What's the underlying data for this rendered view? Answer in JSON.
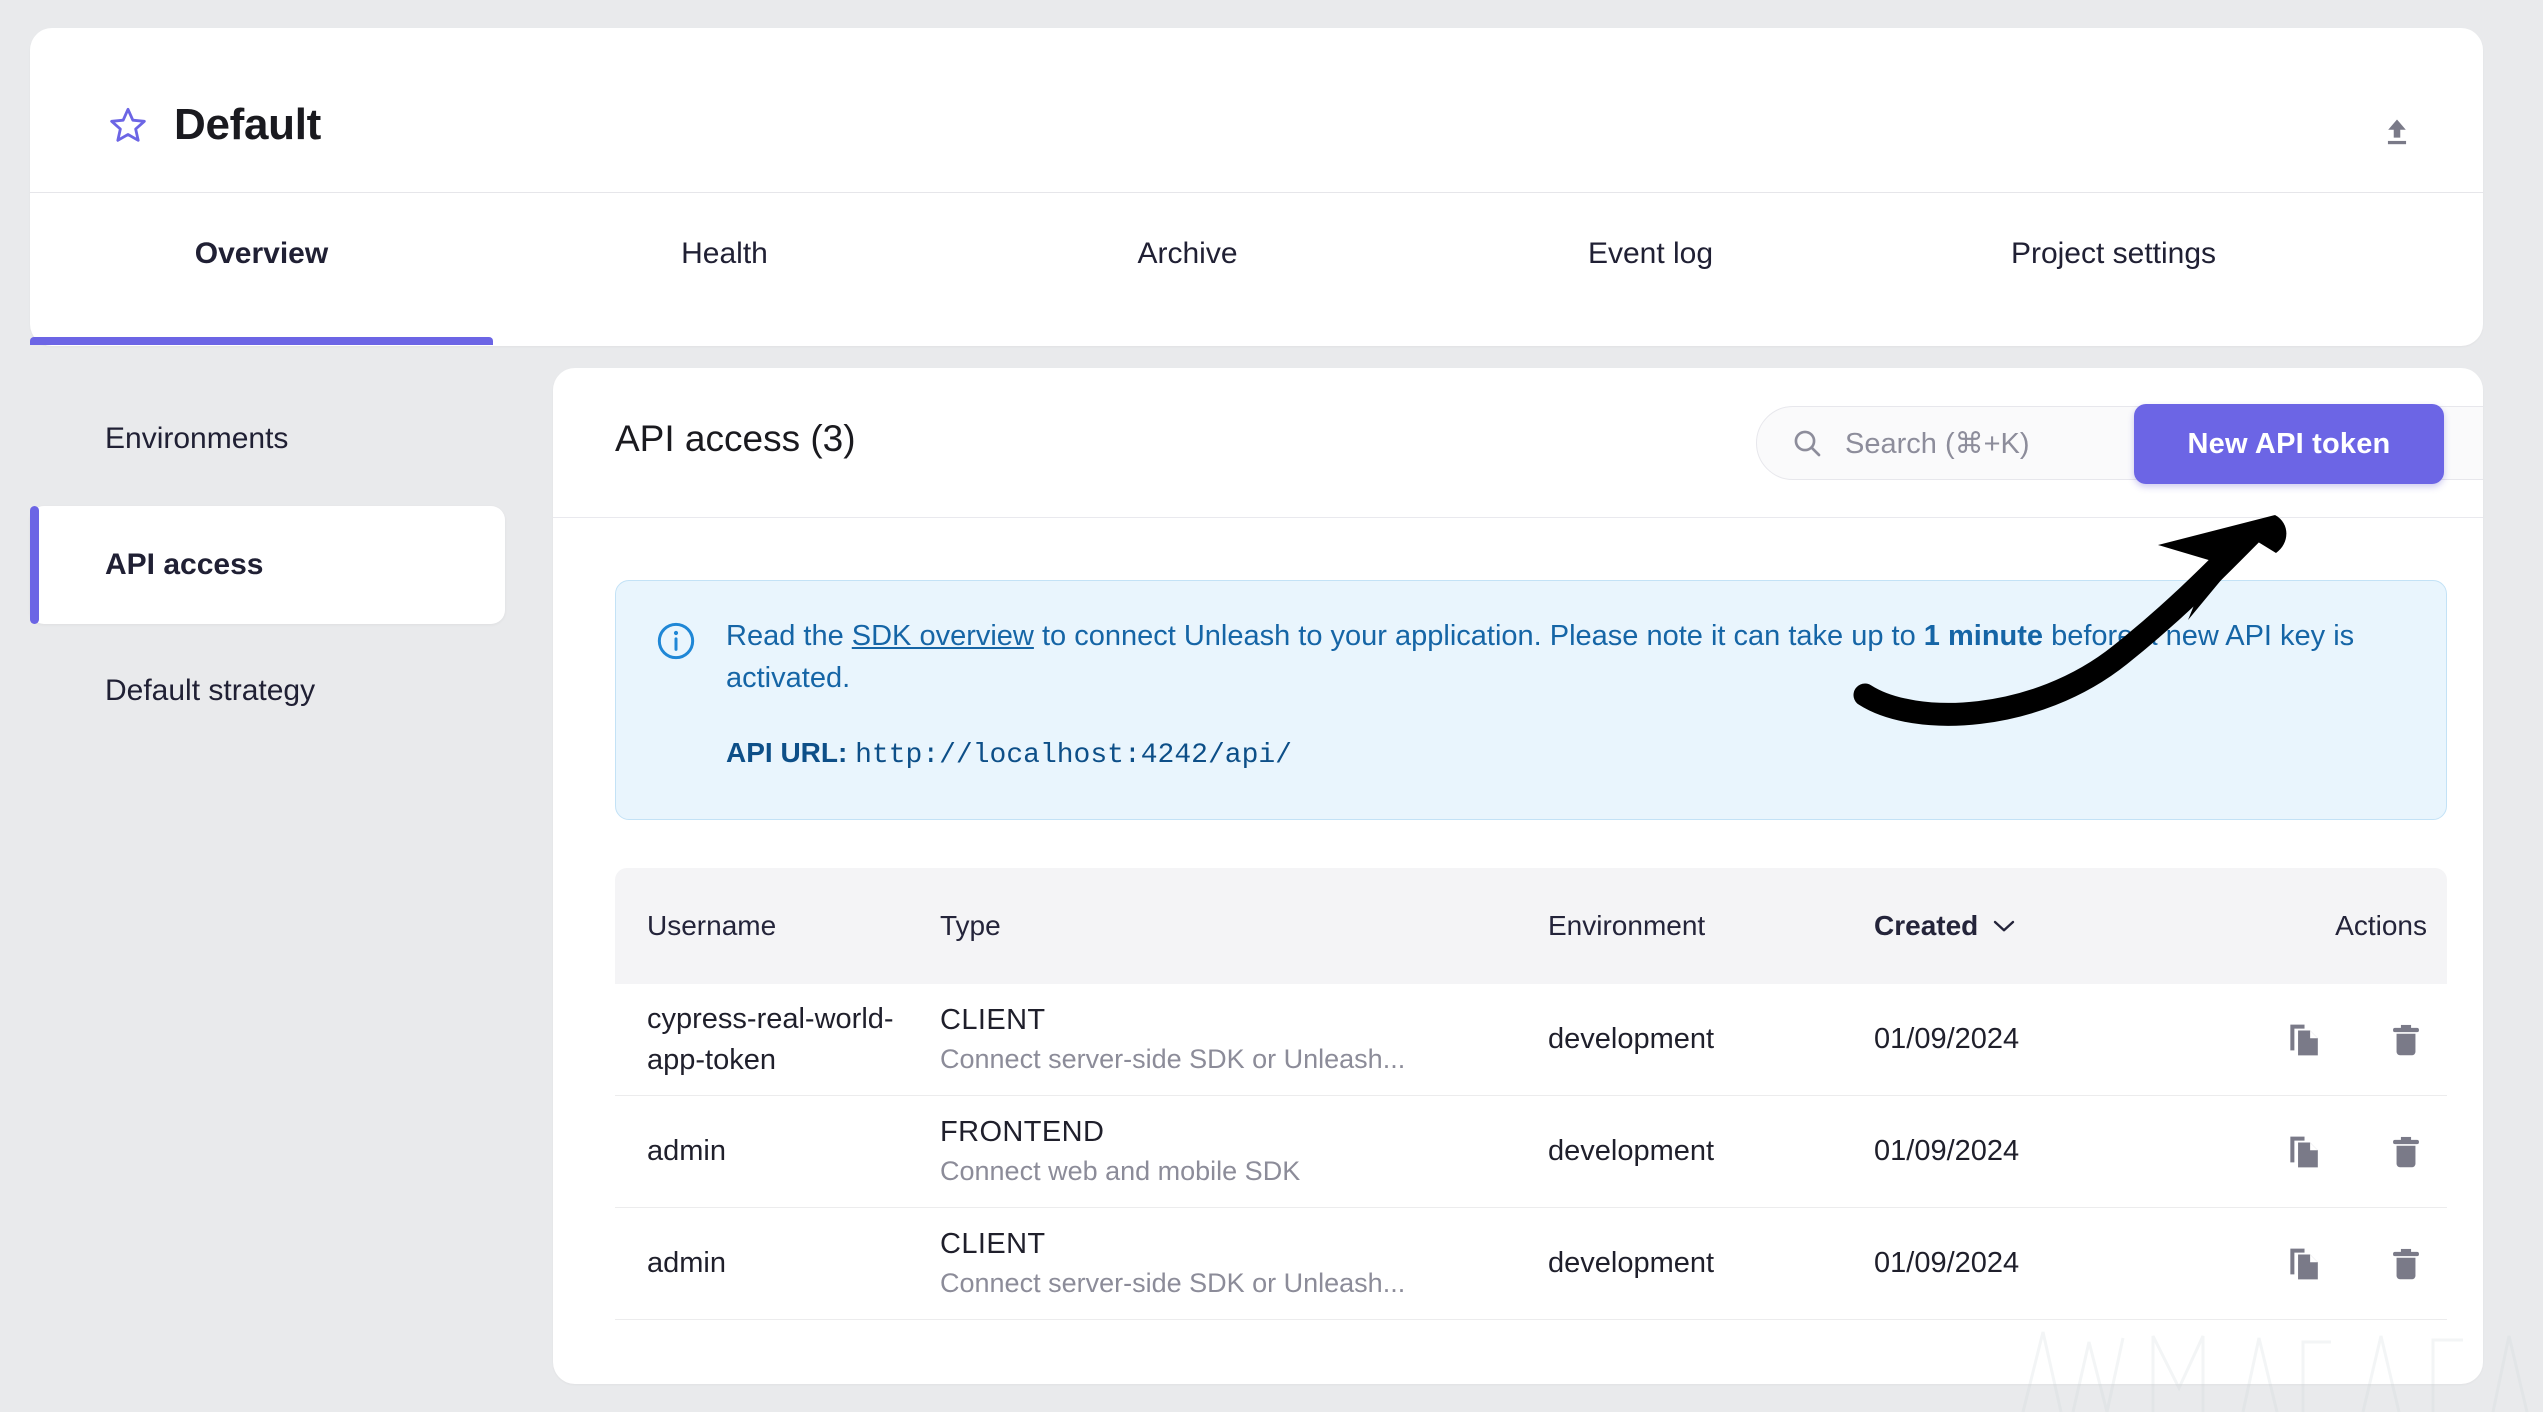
{
  "header": {
    "project_title": "Default",
    "favorite_icon": "star-icon",
    "export_icon": "upload-icon"
  },
  "tabs": [
    {
      "label": "Overview",
      "active": true
    },
    {
      "label": "Health",
      "active": false
    },
    {
      "label": "Archive",
      "active": false
    },
    {
      "label": "Event log",
      "active": false
    },
    {
      "label": "Project settings",
      "active": false
    }
  ],
  "sidebar": {
    "items": [
      {
        "label": "Environments",
        "active": false
      },
      {
        "label": "API access",
        "active": true
      },
      {
        "label": "Default strategy",
        "active": false
      }
    ]
  },
  "main": {
    "title": "API access (3)",
    "search": {
      "placeholder": "Search (⌘+K)",
      "value": "",
      "icon": "search-icon"
    },
    "new_token_button": "New API token",
    "alert": {
      "icon": "info-circle-icon",
      "text_before_link": "Read the ",
      "link_text": "SDK overview",
      "text_after_link": " to connect Unleash to your application. Please note it can take up to ",
      "emphasis": "1 minute",
      "text_end": " before a new API key is activated.",
      "api_url_label": "API URL:",
      "api_url_value": "http://localhost:4242/api/"
    },
    "table": {
      "columns": [
        "Username",
        "Type",
        "Environment",
        "Created",
        "Actions"
      ],
      "sorted_column": "Created",
      "sort_icon": "chevron-down-icon",
      "rows": [
        {
          "username": "cypress-real-world-app-token",
          "type": "CLIENT",
          "type_description": "Connect server-side SDK or Unleash...",
          "environment": "development",
          "created": "01/09/2024",
          "actions": [
            "copy-icon",
            "delete-icon"
          ]
        },
        {
          "username": "admin",
          "type": "FRONTEND",
          "type_description": "Connect web and mobile SDK",
          "environment": "development",
          "created": "01/09/2024",
          "actions": [
            "copy-icon",
            "delete-icon"
          ]
        },
        {
          "username": "admin",
          "type": "CLIENT",
          "type_description": "Connect server-side SDK or Unleash...",
          "environment": "development",
          "created": "01/09/2024",
          "actions": [
            "copy-icon",
            "delete-icon"
          ]
        }
      ]
    }
  },
  "annotation": {
    "arrow_icon": "curved-arrow-annotation",
    "points_to": "New API token"
  },
  "colors": {
    "accent_purple": "#6c65e5",
    "page_background": "#e9eaec",
    "alert_background": "#e9f5fd",
    "alert_text": "#1565a6"
  }
}
